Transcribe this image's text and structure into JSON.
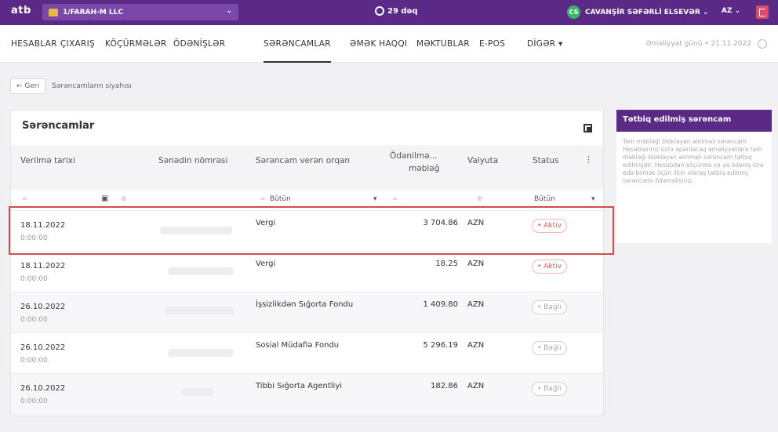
{
  "topbar": {
    "logo": "atb",
    "company": "1/FARAH-M LLC",
    "timer": "29 dəq",
    "user_initials": "CS",
    "user_name": "CAVANŞİR SƏFƏRLİ ELSEVƏR ⌄",
    "language": "AZ ⌄"
  },
  "nav": {
    "items": [
      "HESABLAR",
      "ÇIXARIŞ",
      "KÖÇÜRMƏLƏR",
      "ÖDƏNİŞLƏR",
      "SƏRƏNCAMLAR",
      "ƏMƏK HAQQI",
      "MƏKTUBLAR",
      "E-POS",
      "DİGƏR ▾"
    ],
    "active": "SƏRƏNCAMLAR",
    "operation_day": "Əməliyyat günü • 21.11.2022"
  },
  "breadcrumb": {
    "back_label": "← Geri",
    "current": "Sərəncamların siyahısı"
  },
  "card": {
    "title": "Sərəncamlar",
    "columns": [
      "Verilmə tarixi",
      "Sənədin nömrəsi",
      "Sərəncam verən orqan",
      "Ödənilmə...",
      "məbləğ",
      "Valyuta",
      "Status"
    ],
    "filters": {
      "org": "Bütün",
      "status": "Bütün"
    },
    "rows": [
      {
        "date": "18.11.2022",
        "time": "0:00:00",
        "org": "Vergi",
        "amount": "3 704.86",
        "currency": "AZN",
        "status": "• Aktiv",
        "status_type": "aktiv"
      },
      {
        "date": "18.11.2022",
        "time": "0:00:00",
        "org": "Vergi",
        "amount": "18.25",
        "currency": "AZN",
        "status": "• Aktiv",
        "status_type": "aktiv"
      },
      {
        "date": "26.10.2022",
        "time": "0:00:00",
        "org": "İşsizlikdən Sığorta Fondu",
        "amount": "1 409.80",
        "currency": "AZN",
        "status": "• Bağlı",
        "status_type": "bagli"
      },
      {
        "date": "26.10.2022",
        "time": "0:00:00",
        "org": "Sosial Müdafiə Fondu",
        "amount": "5 296.19",
        "currency": "AZN",
        "status": "• Bağlı",
        "status_type": "bagli"
      },
      {
        "date": "26.10.2022",
        "time": "0:00:00",
        "org": "Tibbi Sığorta Agentliyi",
        "amount": "182.86",
        "currency": "AZN",
        "status": "• Bağlı",
        "status_type": "bagli"
      }
    ]
  },
  "side_panel": {
    "title": "Tətbiq edilmiş sərəncam",
    "body": "Tam məbləği bloklayan alınmalı sərəncam. Hesablarınız üzrə aparılacaq əməliyyatlara tam məbləği bloklayan alınmalı sərəncam tətbiq edilmişdir. Hesabdan köçürmə və ya ödəniş icra edə bilmək üçün ilkin olaraq tətbiq edilmiş sərəncamı ödəməlisiniz."
  },
  "colors": {
    "brand": "#5a2a86",
    "highlight": "#d24c4c",
    "aktiv": "#e25b5b"
  }
}
